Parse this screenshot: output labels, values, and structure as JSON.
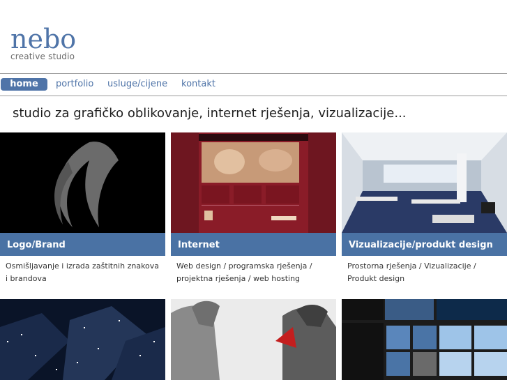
{
  "logo": {
    "name": "nebo",
    "tagline": "creative studio"
  },
  "nav": [
    {
      "label": "home",
      "active": true
    },
    {
      "label": "portfolio"
    },
    {
      "label": "usluge/cijene"
    },
    {
      "label": "kontakt"
    }
  ],
  "tagline": "studio za grafičko oblikovanje, internet rješenja, vizualizacije...",
  "cards": [
    {
      "title": "Logo/Brand",
      "description": "Osmišljavanje i izrada zaštitnih znakova i brandova"
    },
    {
      "title": "Internet",
      "description": "Web design / programska rješenja / projektna rješenja / web hosting"
    },
    {
      "title": "Vizualizacije/produkt design",
      "description": "Prostorna rješenja / Vizualizacije / Produkt design"
    }
  ],
  "colors": {
    "brand_blue": "#4f74a8",
    "bar_blue": "#4a72a4"
  }
}
